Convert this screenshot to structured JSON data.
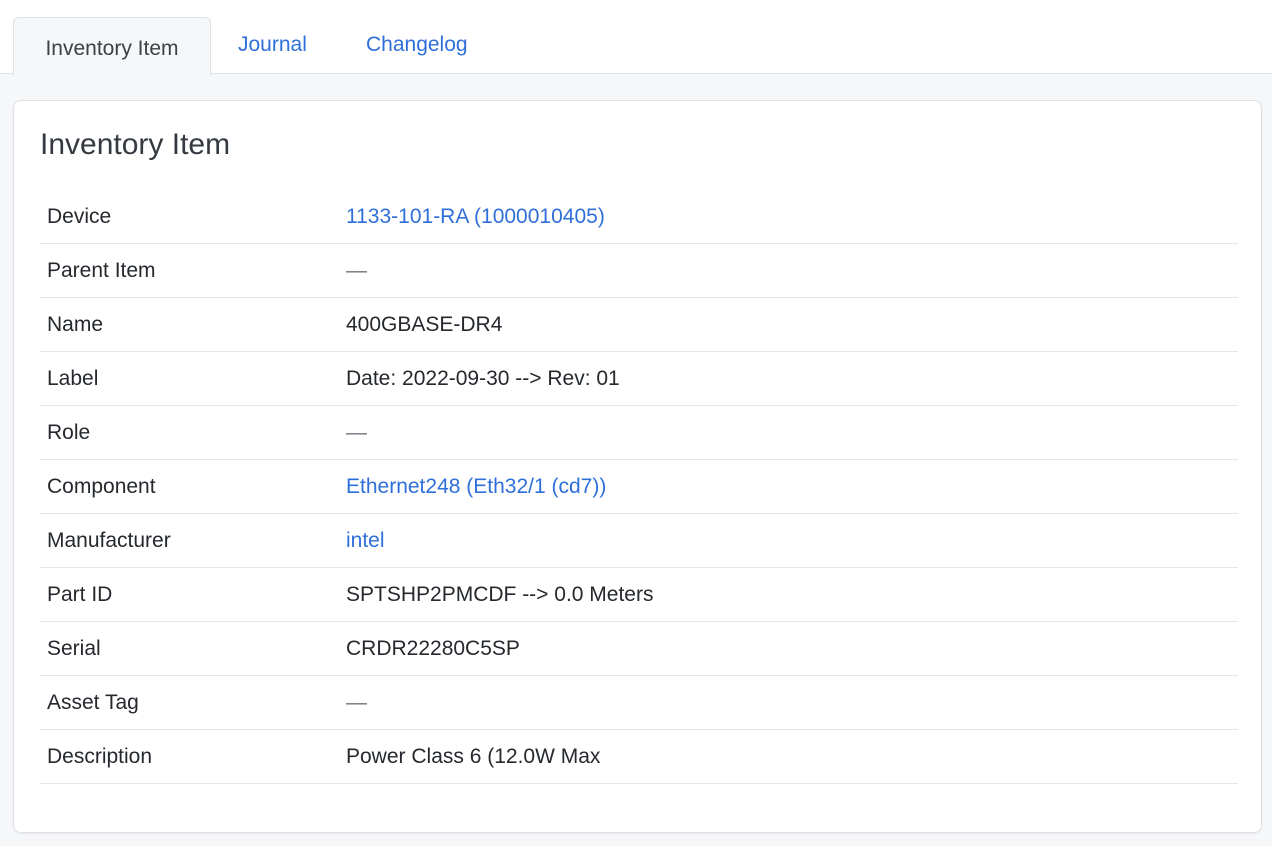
{
  "tabs": {
    "inventory_item": "Inventory Item",
    "journal": "Journal",
    "changelog": "Changelog"
  },
  "card": {
    "title": "Inventory Item"
  },
  "rows": {
    "device": {
      "label": "Device",
      "value": "1133-101-RA (1000010405)"
    },
    "parent_item": {
      "label": "Parent Item",
      "value": "—"
    },
    "name": {
      "label": "Name",
      "value": "400GBASE-DR4"
    },
    "label": {
      "label": "Label",
      "value": "Date: 2022-09-30 --> Rev: 01"
    },
    "role": {
      "label": "Role",
      "value": "—"
    },
    "component": {
      "label": "Component",
      "value": "Ethernet248 (Eth32/1 (cd7))"
    },
    "manufacturer": {
      "label": "Manufacturer",
      "value": "intel"
    },
    "part_id": {
      "label": "Part ID",
      "value": "SPTSHP2PMCDF --> 0.0 Meters"
    },
    "serial": {
      "label": "Serial",
      "value": "CRDR22280C5SP"
    },
    "asset_tag": {
      "label": "Asset Tag",
      "value": "—"
    },
    "description": {
      "label": "Description",
      "value": "Power Class 6 (12.0W Max"
    }
  },
  "colors": {
    "link": "#2f6fd9",
    "text": "#25292e",
    "muted": "#6c757d",
    "border": "#e3e6ea",
    "page_background": "#f6f7f8"
  }
}
